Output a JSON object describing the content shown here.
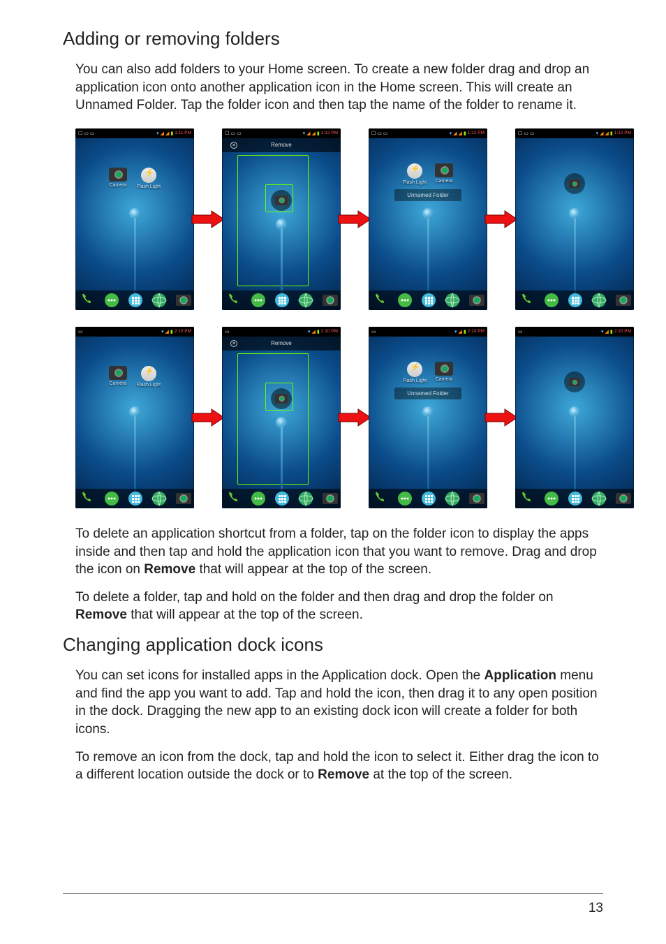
{
  "heading_folders": "Adding or removing folders",
  "p_folders_intro": "You can also add folders to your Home screen. To create a new folder drag and drop an application icon onto another application icon in the Home screen. This will create an Unnamed Folder. Tap the folder icon and then tap the name of the folder to rename it.",
  "shots_row1": {
    "time1": "1:11",
    "time2": "1:12",
    "time3": "1:12",
    "time4": "1:12",
    "pm": "PM",
    "remove_label": "Remove",
    "app_camera": "Camera",
    "app_flashlight": "Flash Light",
    "folder_label": "Unnamed Folder"
  },
  "shots_row2": {
    "time": "2:10",
    "pm": "PM",
    "remove_label": "Remove",
    "app_camera": "Camera",
    "app_flashlight": "Flash Light",
    "folder_label": "Unnamed Folder"
  },
  "p_delete_shortcut_a": "To delete an application shortcut from a folder, tap on the folder icon to display the apps inside and then tap and hold the application icon that you want to remove. Drag and drop the icon on ",
  "p_delete_shortcut_b": "Remove",
  "p_delete_shortcut_c": " that will appear at the top of the screen.",
  "p_delete_folder_a": "To delete a folder, tap and hold on the folder and then drag and drop the folder on ",
  "p_delete_folder_b": "Remove",
  "p_delete_folder_c": " that will appear at the top of the screen.",
  "heading_dock": "Changing application dock icons",
  "p_dock_intro_a": "You can set icons for installed apps in the Application dock. Open the ",
  "p_dock_intro_b": "Application",
  "p_dock_intro_c": " menu and find the app you want to add. Tap and hold the icon, then drag it to any open position in the dock. Dragging the new app to an existing dock icon will create a folder for both icons.",
  "p_dock_remove_a": "To remove an icon from the dock, tap and hold the icon to select it. Either drag the icon to a different location outside the dock or to ",
  "p_dock_remove_b": "Remove",
  "p_dock_remove_c": " at the top of the screen.",
  "page_number": "13"
}
